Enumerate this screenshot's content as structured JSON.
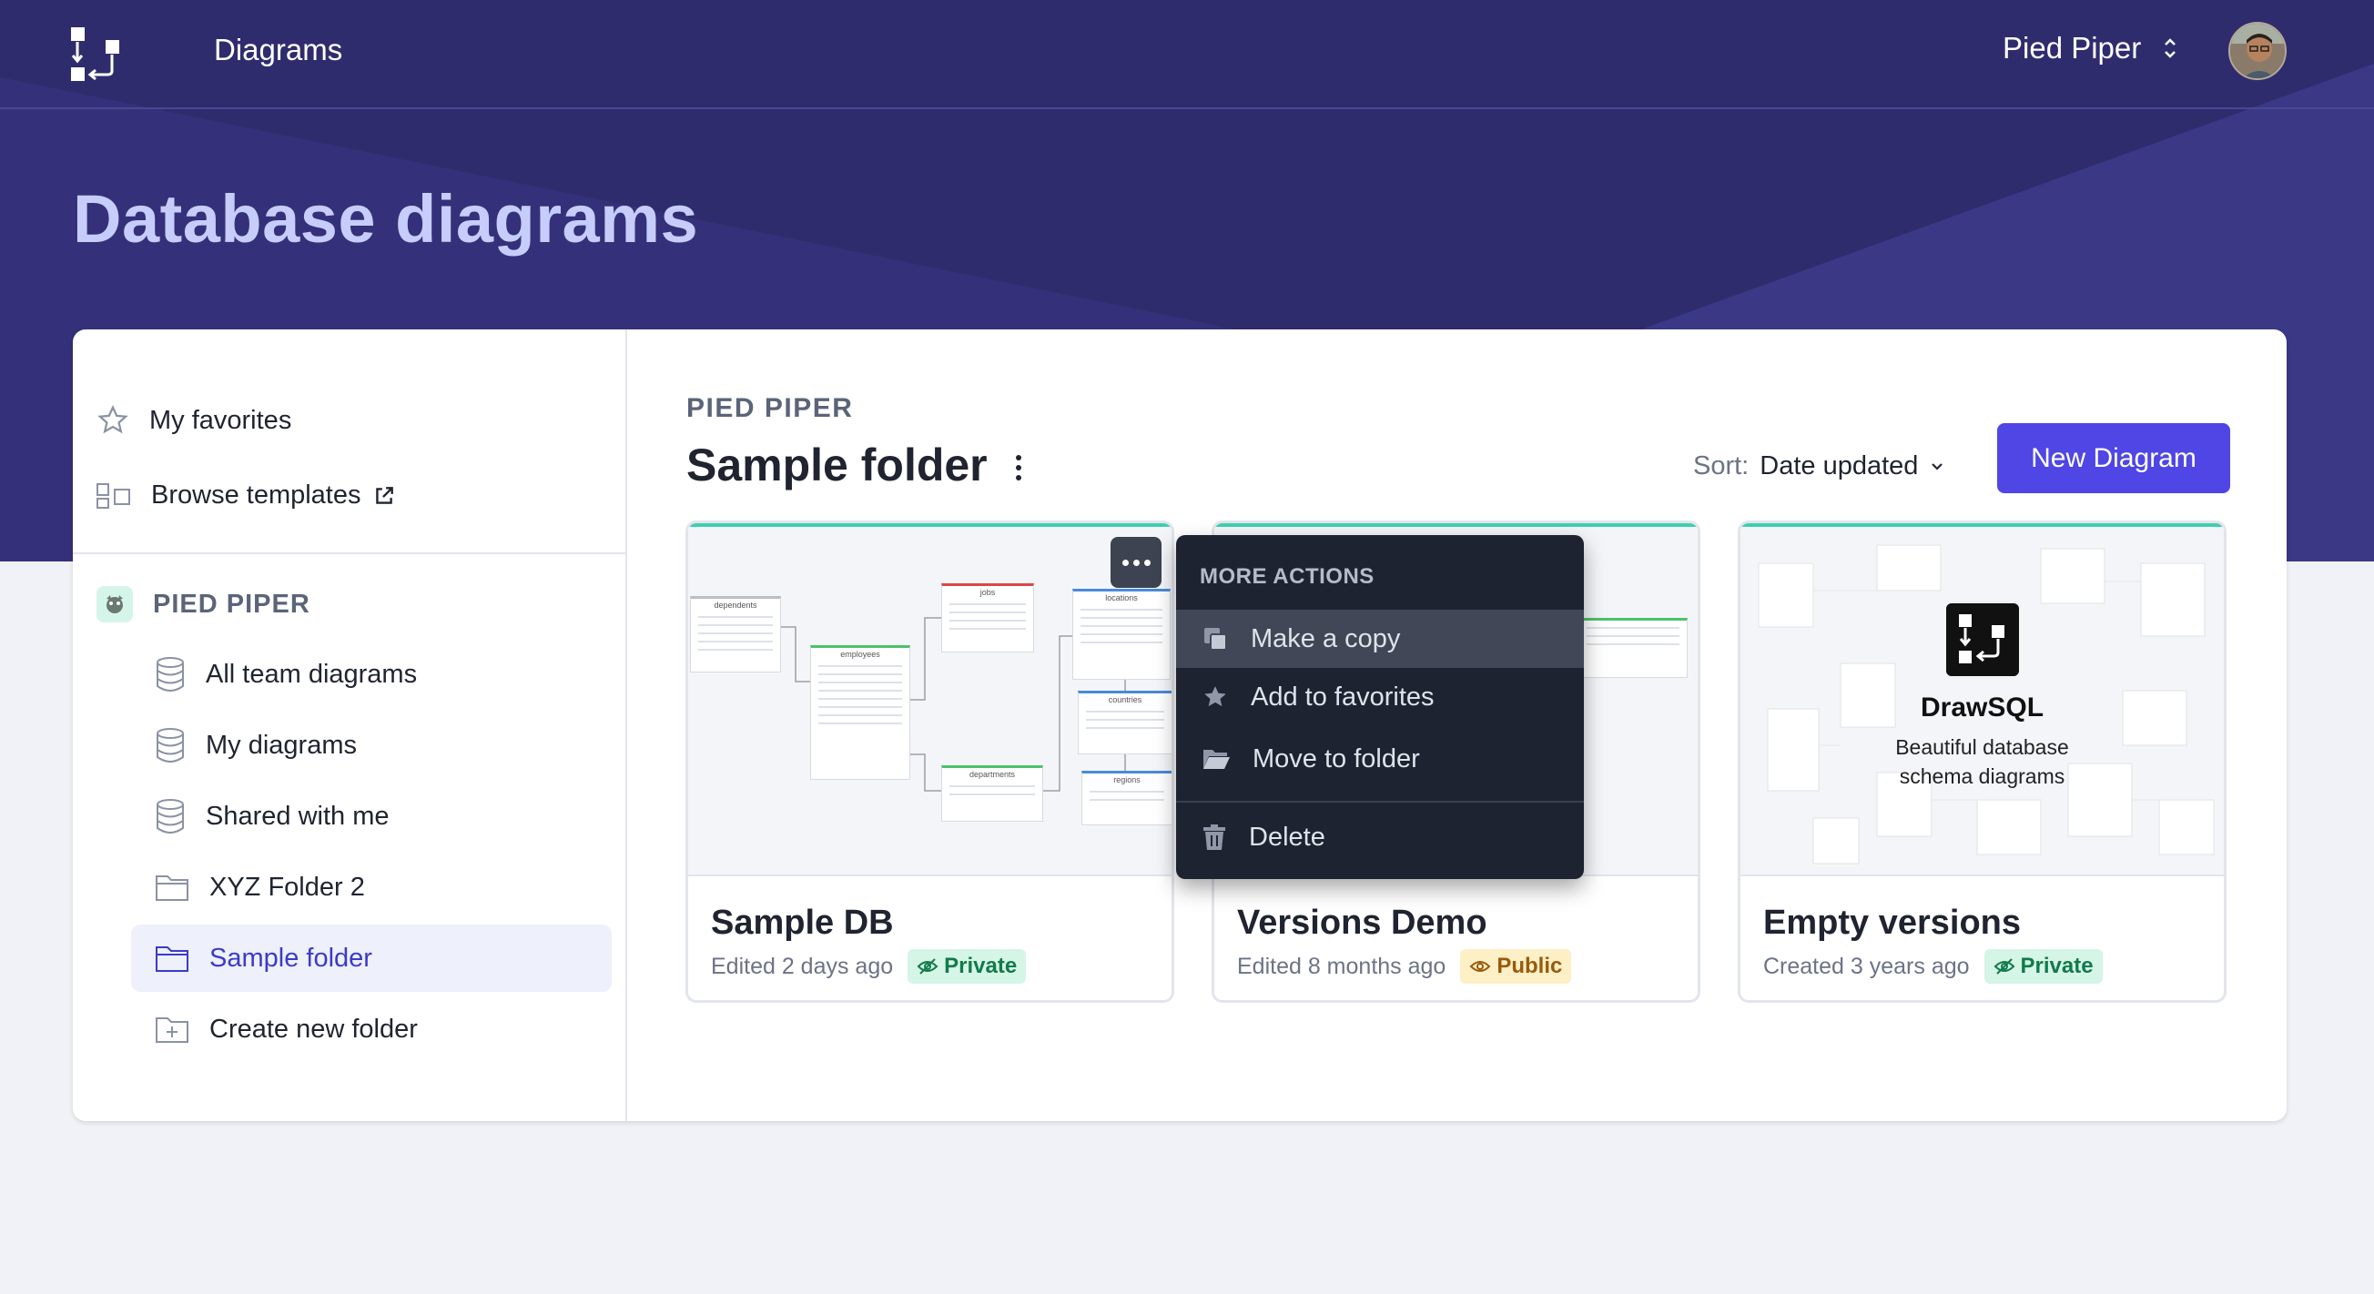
{
  "app": {
    "brand": "Diagrams",
    "team_switcher": "Pied Piper"
  },
  "page": {
    "title": "Database diagrams"
  },
  "sidebar": {
    "favorites": "My favorites",
    "templates": "Browse templates",
    "team_name": "PIED PIPER",
    "items": [
      {
        "label": "All team diagrams",
        "icon": "database-icon"
      },
      {
        "label": "My diagrams",
        "icon": "database-icon"
      },
      {
        "label": "Shared with me",
        "icon": "database-icon"
      },
      {
        "label": "XYZ Folder 2",
        "icon": "folder-icon"
      },
      {
        "label": "Sample folder",
        "icon": "folder-icon",
        "active": true
      },
      {
        "label": "Create new folder",
        "icon": "folder-plus-icon"
      }
    ]
  },
  "content": {
    "team": "PIED PIPER",
    "folder_title": "Sample folder",
    "sort_label": "Sort:",
    "sort_value": "Date updated",
    "new_button": "New Diagram"
  },
  "cards": [
    {
      "name": "Sample DB",
      "meta": "Edited 2 days ago",
      "badge": "Private",
      "visibility": "private"
    },
    {
      "name": "Versions Demo",
      "meta": "Edited 8 months ago",
      "badge": "Public",
      "visibility": "public"
    },
    {
      "name": "Empty versions",
      "meta": "Created 3 years ago",
      "badge": "Private",
      "visibility": "private"
    }
  ],
  "thumbnail": {
    "tables": [
      "dependents",
      "employees",
      "jobs",
      "locations",
      "countries",
      "departments",
      "regions"
    ],
    "drawsql_name": "DrawSQL",
    "drawsql_line1": "Beautiful database",
    "drawsql_line2": "schema diagrams"
  },
  "menu": {
    "heading": "MORE ACTIONS",
    "items": [
      "Make a copy",
      "Add to favorites",
      "Move to folder",
      "Delete"
    ]
  },
  "colors": {
    "primary": "#4f46e5",
    "hero": "#2f2c6e",
    "title": "#c7cdfb",
    "accent_teal": "#3ecfb0",
    "menu_bg": "#1e2331"
  }
}
